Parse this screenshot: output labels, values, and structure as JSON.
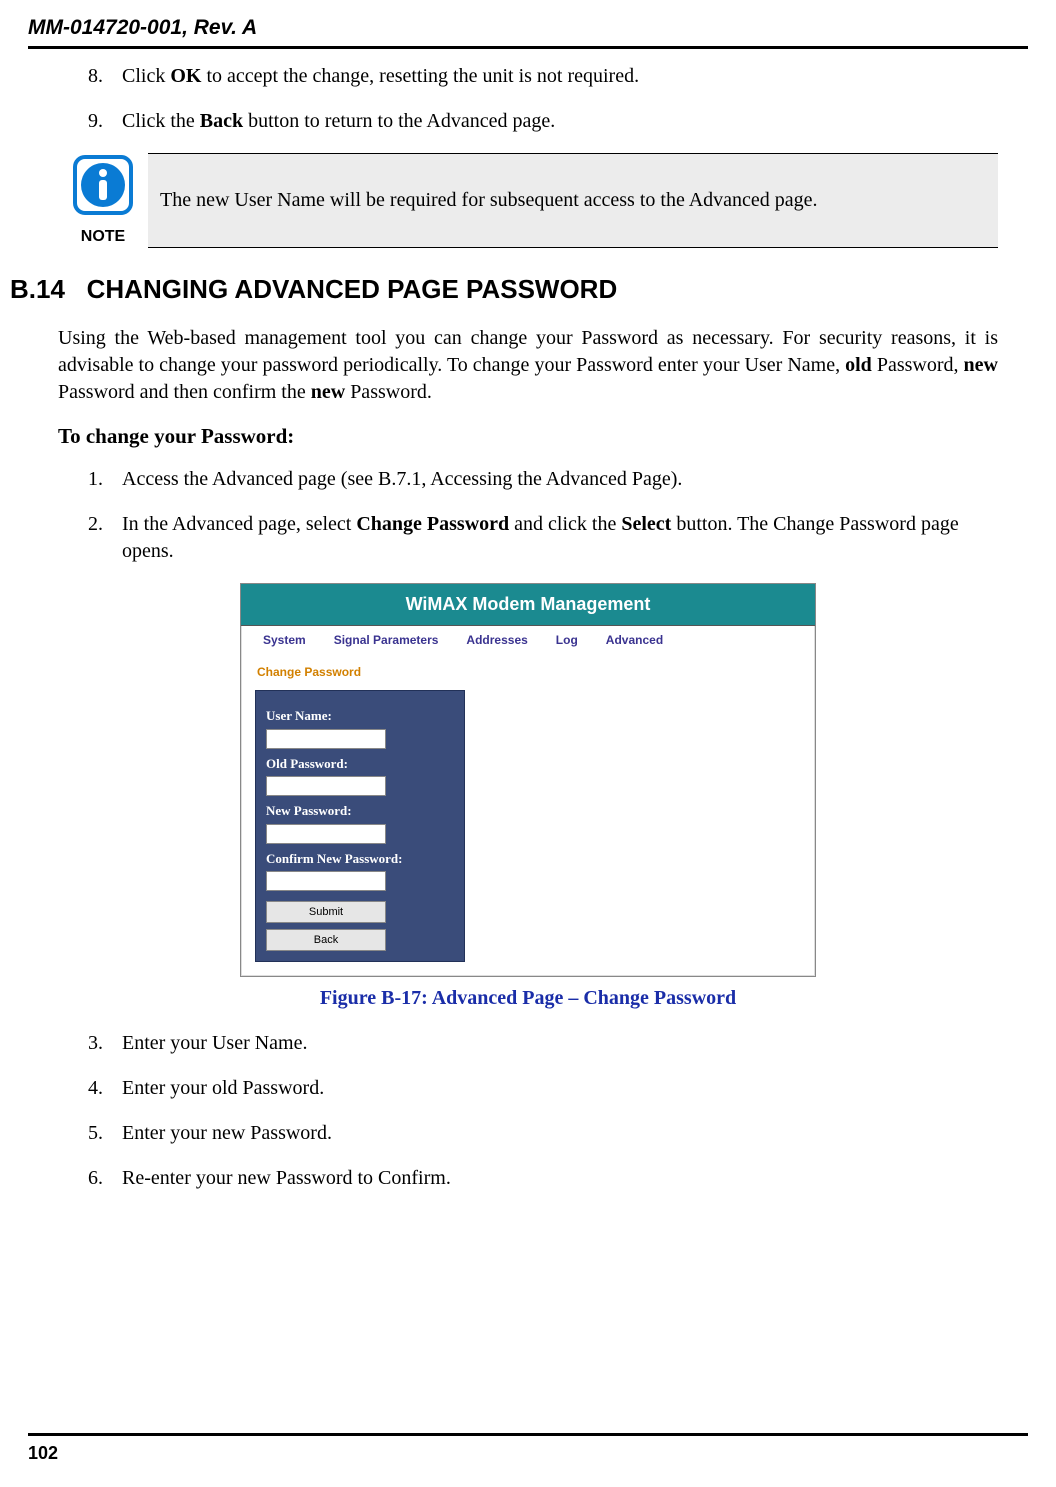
{
  "header": {
    "doc_id": "MM-014720-001, Rev. A"
  },
  "steps_top": [
    {
      "num": "8.",
      "pre": "Click ",
      "bold": "OK",
      "post": " to accept the change, resetting the unit is not required."
    },
    {
      "num": "9.",
      "pre": "Click the ",
      "bold": "Back",
      "post": " button to return to the Advanced page."
    }
  ],
  "note": {
    "label": "NOTE",
    "text": "The new User Name will be required for subsequent access to the Advanced page."
  },
  "section": {
    "number": "B.14",
    "title": "CHANGING ADVANCED PAGE PASSWORD"
  },
  "intro": {
    "p1_a": "Using the Web-based management tool you can change your Password as necessary.  For security reasons, it is advisable to change your password periodically.  To change your Password enter your User Name, ",
    "b1": "old",
    "p1_b": " Password, ",
    "b2": "new",
    "p1_c": " Password and then confirm the ",
    "b3": "new",
    "p1_d": " Password."
  },
  "subhead": "To change your Password:",
  "steps_mid": [
    {
      "num": "1.",
      "text": "Access the Advanced page (see B.7.1, Accessing the Advanced Page)."
    },
    {
      "num": "2.",
      "pre": "In the Advanced page, select ",
      "b1": "Change Password",
      "mid": " and click the ",
      "b2": "Select",
      "post": " button.  The Change Password page opens."
    }
  ],
  "wimax": {
    "title": "WiMAX Modem Management",
    "tabs": [
      "System",
      "Signal Parameters",
      "Addresses",
      "Log",
      "Advanced"
    ],
    "page_title": "Change Password",
    "fields": {
      "user": "User Name:",
      "old": "Old Password:",
      "new": "New Password:",
      "confirm": "Confirm New Password:"
    },
    "buttons": {
      "submit": "Submit",
      "back": "Back"
    }
  },
  "figure_caption": "Figure B-17:  Advanced Page – Change Password",
  "steps_bottom": [
    {
      "num": "3.",
      "text": "Enter your User Name."
    },
    {
      "num": "4.",
      "text": "Enter your old Password."
    },
    {
      "num": "5.",
      "text": "Enter your new Password."
    },
    {
      "num": "6.",
      "text": "Re-enter your new Password to Confirm."
    }
  ],
  "page_number": "102"
}
